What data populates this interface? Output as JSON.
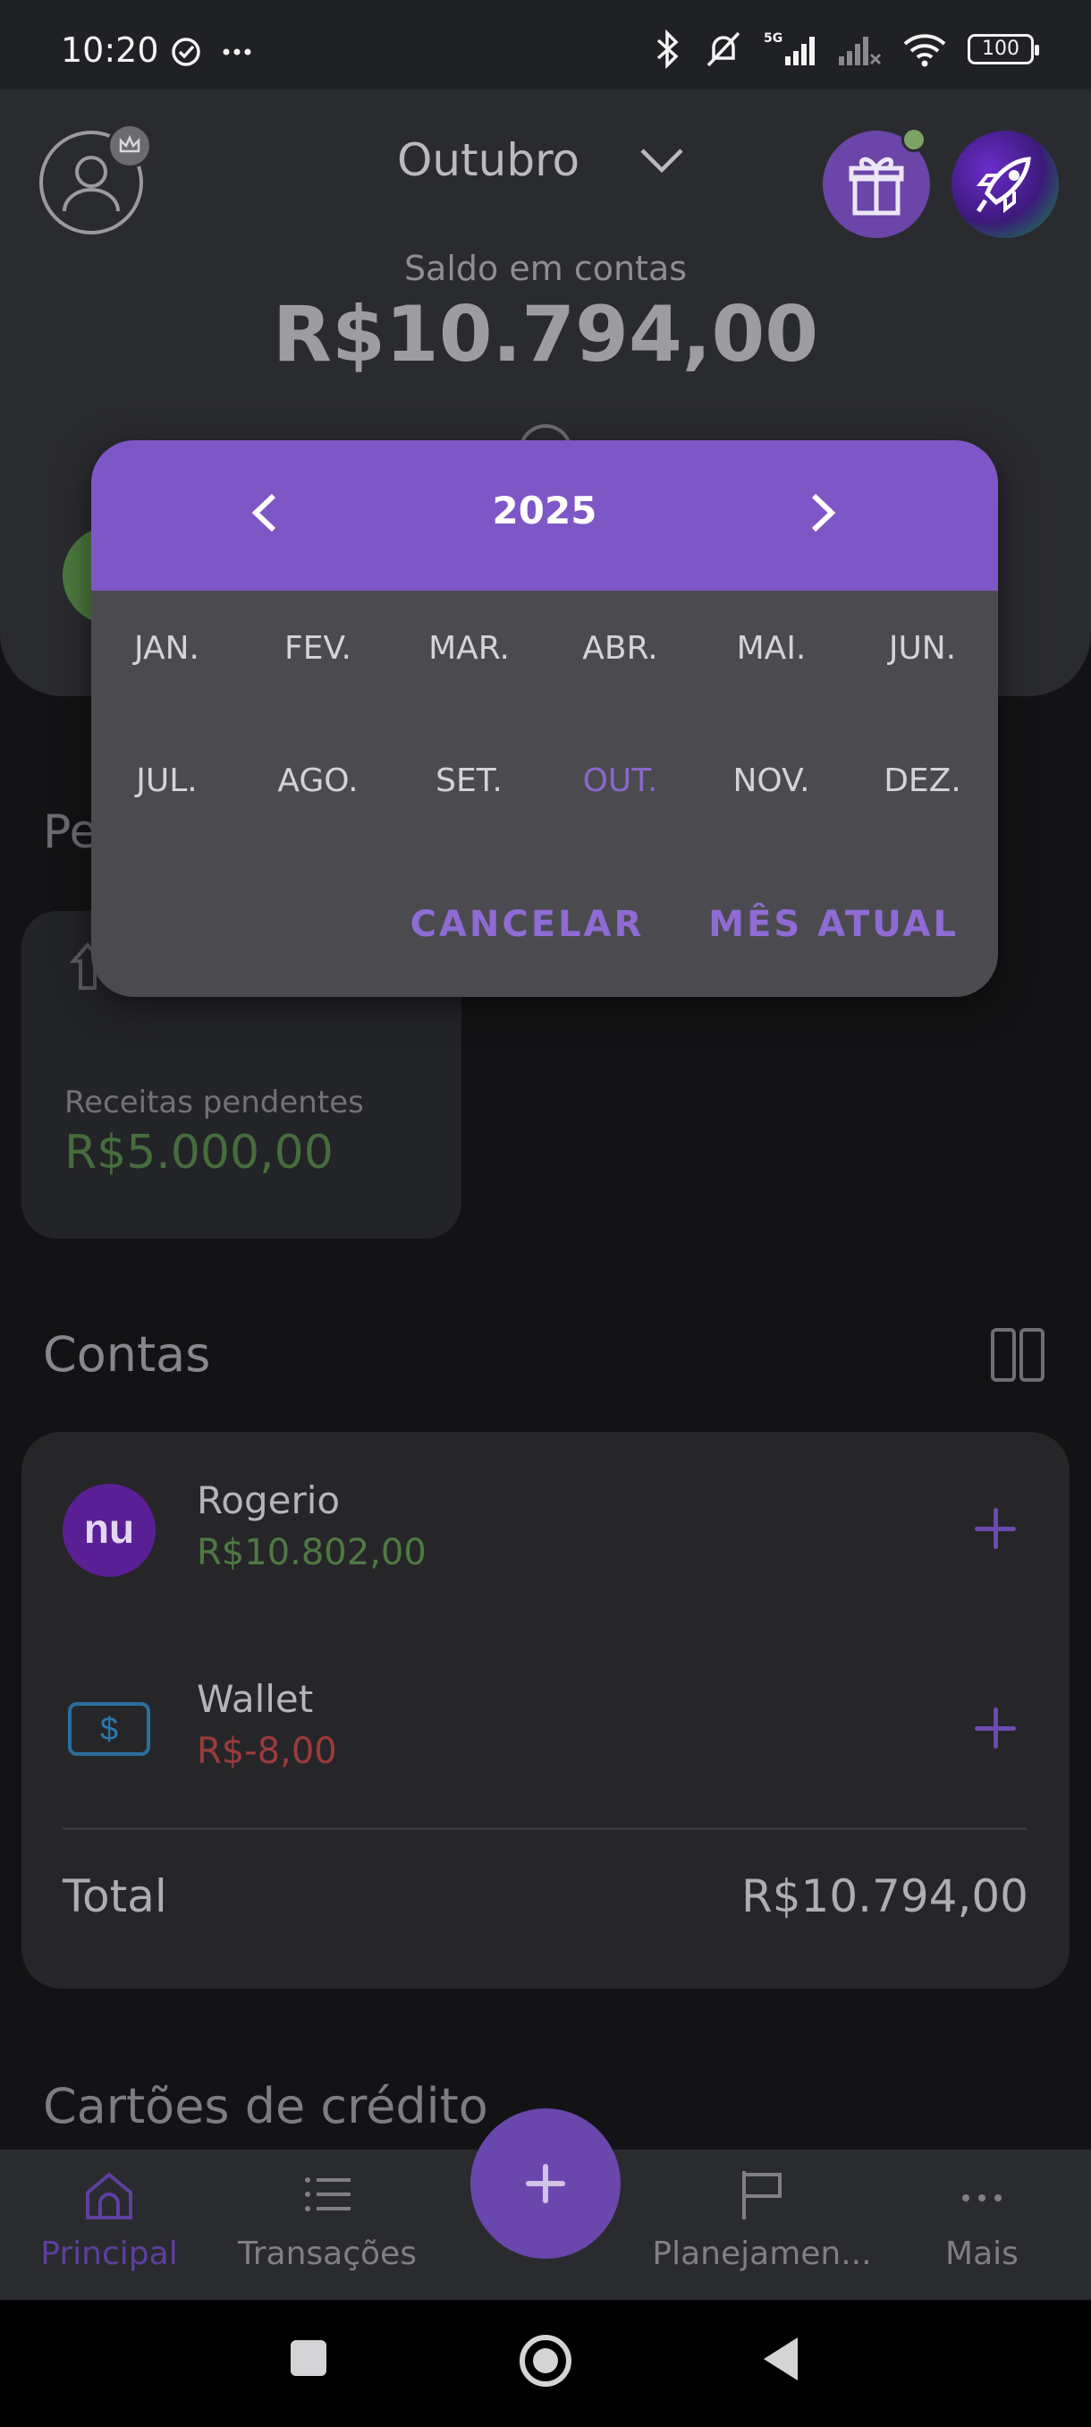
{
  "status_bar": {
    "time": "10:20",
    "battery": "100",
    "network": "5G"
  },
  "header": {
    "month": "Outubro",
    "saldo_label": "Saldo em contas",
    "saldo_value": "R$10.794,00"
  },
  "pending": {
    "section_title_partial": "Pe",
    "label": "Receitas pendentes",
    "value": "R$5.000,00"
  },
  "contas": {
    "title": "Contas",
    "accounts": [
      {
        "name": "Rogerio",
        "value": "R$10.802,00",
        "logo_text": "nu"
      },
      {
        "name": "Wallet",
        "value": "R$-8,00",
        "logo_text": "$"
      }
    ],
    "total_label": "Total",
    "total_value": "R$10.794,00"
  },
  "cartoes": {
    "title": "Cartões de crédito"
  },
  "bottom_nav": {
    "items": [
      {
        "label": "Principal"
      },
      {
        "label": "Transações"
      },
      {
        "label": "Planejamen..."
      },
      {
        "label": "Mais"
      }
    ]
  },
  "dialog": {
    "year": "2025",
    "months": [
      "JAN.",
      "FEV.",
      "MAR.",
      "ABR.",
      "MAI.",
      "JUN.",
      "JUL.",
      "AGO.",
      "SET.",
      "OUT.",
      "NOV.",
      "DEZ."
    ],
    "selected_month": "OUT.",
    "cancel_label": "CANCELAR",
    "current_label": "MÊS ATUAL"
  },
  "colors": {
    "accent": "#7e57c6",
    "positive": "#4d7a42",
    "negative": "#9c3b3b"
  }
}
